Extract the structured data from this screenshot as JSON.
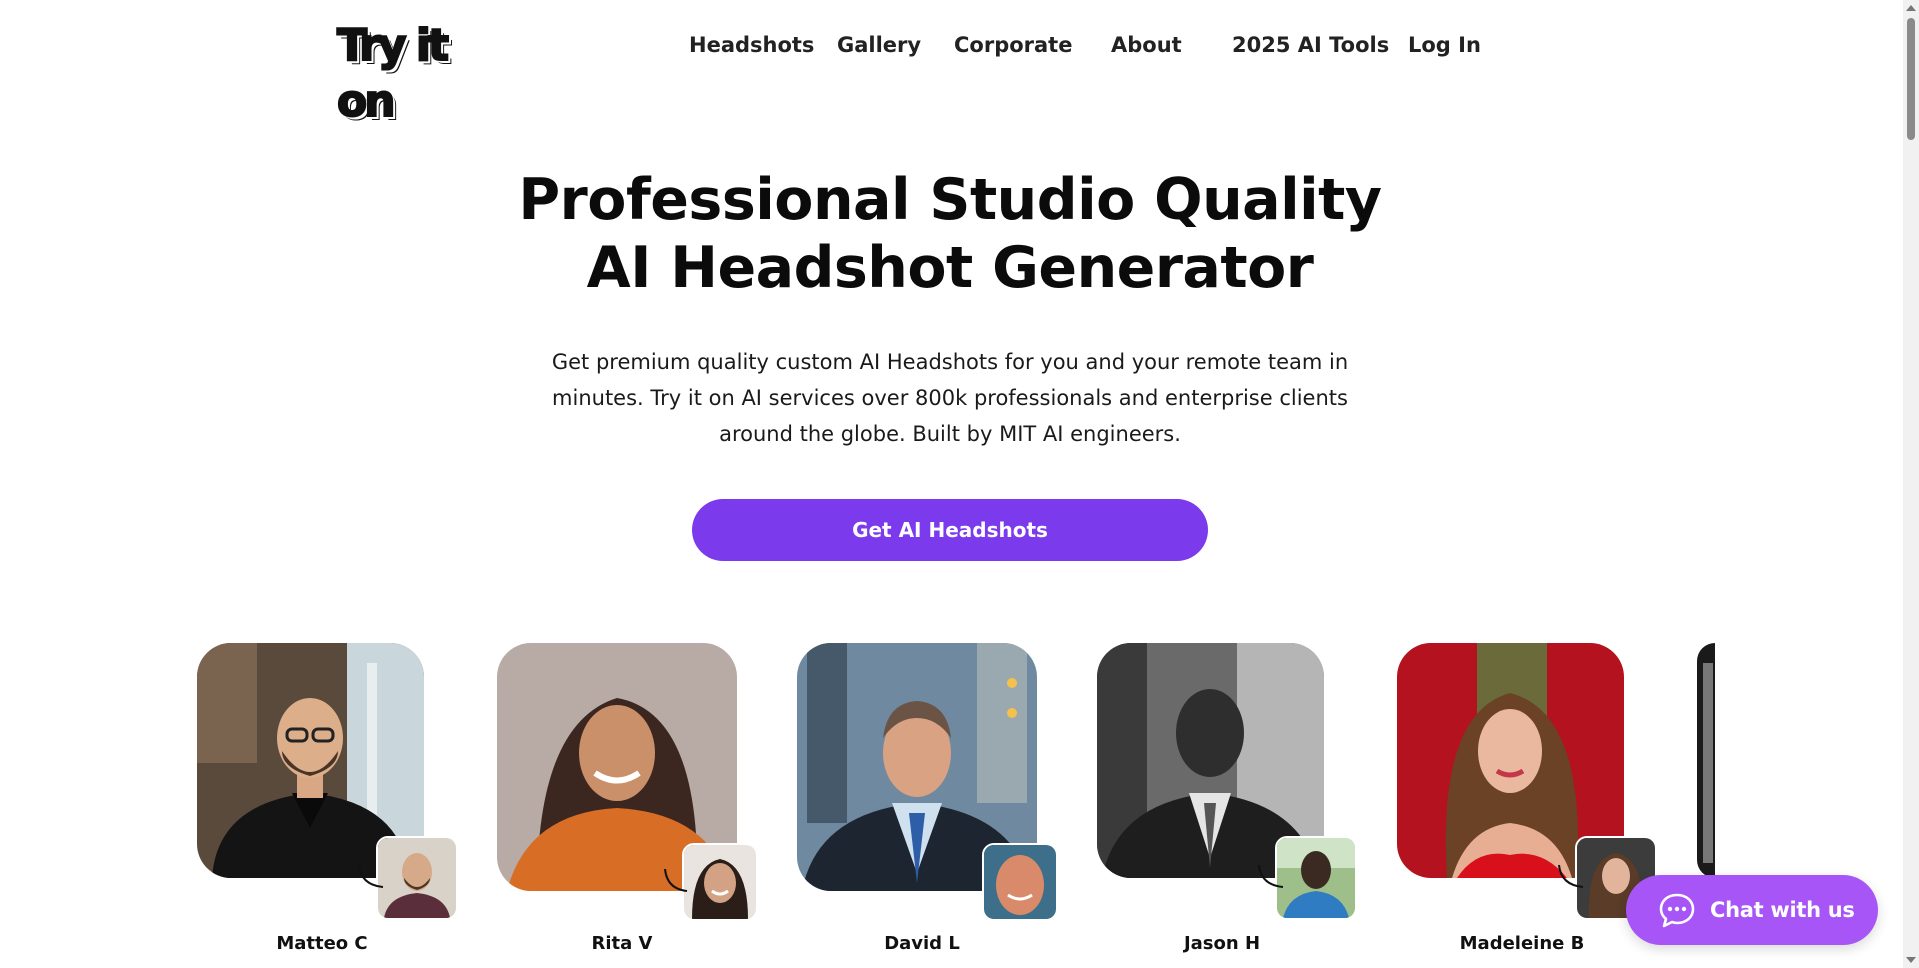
{
  "header": {
    "logo_text": "Try it on",
    "nav": [
      {
        "label": "Headshots"
      },
      {
        "label": "Gallery"
      },
      {
        "label": "Corporate"
      },
      {
        "label": "About"
      },
      {
        "label": "2025 AI Tools"
      },
      {
        "label": "Log In"
      }
    ]
  },
  "hero": {
    "title_line1": "Professional Studio Quality",
    "title_line2": "AI Headshot Generator",
    "subtitle_line1": "Get premium quality custom AI Headshots for you and your remote team in",
    "subtitle_line2": "minutes. Try it on AI services over 800k professionals and enterprise clients",
    "subtitle_line3": "around the globe. Built by MIT AI engineers.",
    "cta_label": "Get AI Headshots"
  },
  "gallery": [
    {
      "name": "Matteo C"
    },
    {
      "name": "Rita V"
    },
    {
      "name": "David L"
    },
    {
      "name": "Jason H"
    },
    {
      "name": "Madeleine B"
    }
  ],
  "chat": {
    "label": "Chat with us",
    "icon": "chat-bubble-icon"
  },
  "colors": {
    "accent": "#7c3aed",
    "chat": "#a855f7"
  }
}
